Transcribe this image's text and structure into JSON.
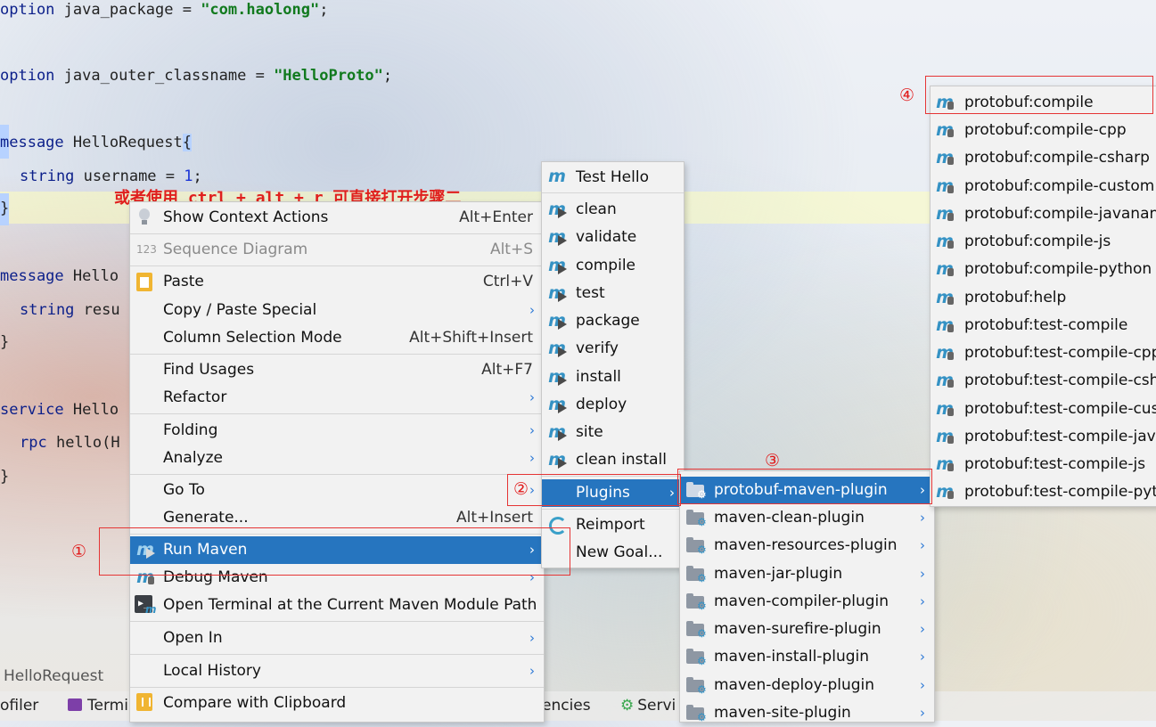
{
  "code": {
    "lines": [
      [
        "option",
        " java_package = ",
        "\"com.haolong\"",
        ";"
      ],
      [
        "option",
        " java_outer_classname = ",
        "\"HelloProto\"",
        ";"
      ],
      [
        "message",
        " HelloRequest",
        "{"
      ],
      [
        "string",
        " username = ",
        "1",
        ";"
      ],
      [
        "}"
      ],
      [
        "message",
        " Hello"
      ],
      [
        "string",
        " resu"
      ],
      [
        "}"
      ],
      [
        "service",
        " Hello"
      ],
      [
        "rpc",
        " hello(H"
      ],
      [
        "}"
      ]
    ],
    "annotation": "或者使用 ctrl + alt + r 可直接打开步骤二"
  },
  "status": {
    "breadcrumb": "HelloRequest",
    "tool_windows": [
      "ofiler",
      "Termi",
      "encies",
      "Servi"
    ]
  },
  "context_menu": {
    "items": [
      {
        "label": "Show Context Actions",
        "shortcut": "Alt+Enter",
        "icon": "bulb-icon"
      },
      {
        "label": "Sequence Diagram",
        "shortcut": "Alt+S",
        "icon": "sequence-icon",
        "disabled": true
      },
      {
        "label": "Paste",
        "shortcut": "Ctrl+V",
        "icon": "clipboard-icon"
      },
      {
        "label": "Copy / Paste Special"
      },
      {
        "label": "Column Selection Mode",
        "shortcut": "Alt+Shift+Insert"
      },
      {
        "label": "Find Usages",
        "shortcut": "Alt+F7"
      },
      {
        "label": "Refactor"
      },
      {
        "label": "Folding"
      },
      {
        "label": "Analyze"
      },
      {
        "label": "Go To"
      },
      {
        "label": "Generate...",
        "shortcut": "Alt+Insert"
      },
      {
        "label": "Run Maven",
        "icon": "maven-run-icon",
        "selected": true
      },
      {
        "label": "Debug Maven",
        "icon": "maven-debug-icon"
      },
      {
        "label": "Open Terminal at the Current Maven Module Path",
        "icon": "terminal-icon"
      },
      {
        "label": "Open In"
      },
      {
        "label": "Local History"
      },
      {
        "label": "Compare with Clipboard",
        "icon": "compare-clipboard-icon"
      }
    ],
    "sequence_icon_text": "123"
  },
  "maven_menu": {
    "items": [
      {
        "label": "Test Hello"
      },
      {
        "label": "clean"
      },
      {
        "label": "validate"
      },
      {
        "label": "compile"
      },
      {
        "label": "test"
      },
      {
        "label": "package"
      },
      {
        "label": "verify"
      },
      {
        "label": "install"
      },
      {
        "label": "deploy"
      },
      {
        "label": "site"
      },
      {
        "label": "clean install"
      },
      {
        "label": "Plugins",
        "selected": true
      },
      {
        "label": "Reimport"
      },
      {
        "label": "New Goal..."
      }
    ]
  },
  "plugins_menu": {
    "items": [
      {
        "label": "protobuf-maven-plugin",
        "selected": true
      },
      {
        "label": "maven-clean-plugin"
      },
      {
        "label": "maven-resources-plugin"
      },
      {
        "label": "maven-jar-plugin"
      },
      {
        "label": "maven-compiler-plugin"
      },
      {
        "label": "maven-surefire-plugin"
      },
      {
        "label": "maven-install-plugin"
      },
      {
        "label": "maven-deploy-plugin"
      },
      {
        "label": "maven-site-plugin"
      }
    ]
  },
  "goals_menu": {
    "items": [
      "protobuf:compile",
      "protobuf:compile-cpp",
      "protobuf:compile-csharp",
      "protobuf:compile-custom",
      "protobuf:compile-javanano",
      "protobuf:compile-js",
      "protobuf:compile-python",
      "protobuf:help",
      "protobuf:test-compile",
      "protobuf:test-compile-cpp",
      "protobuf:test-compile-csharp",
      "protobuf:test-compile-custom",
      "protobuf:test-compile-javanano",
      "protobuf:test-compile-js",
      "protobuf:test-compile-python"
    ]
  },
  "markers": {
    "step1": "①",
    "step2": "②",
    "step3": "③",
    "step4": "④"
  },
  "glyphs": {
    "arrow": "›",
    "maven": "m",
    "gear": "⚙",
    "bulb": "💡",
    "terminal": "▶_"
  },
  "colors": {
    "selection": "#2675bf",
    "highlight_box": "#e53535",
    "maven_icon": "#3592c4"
  }
}
